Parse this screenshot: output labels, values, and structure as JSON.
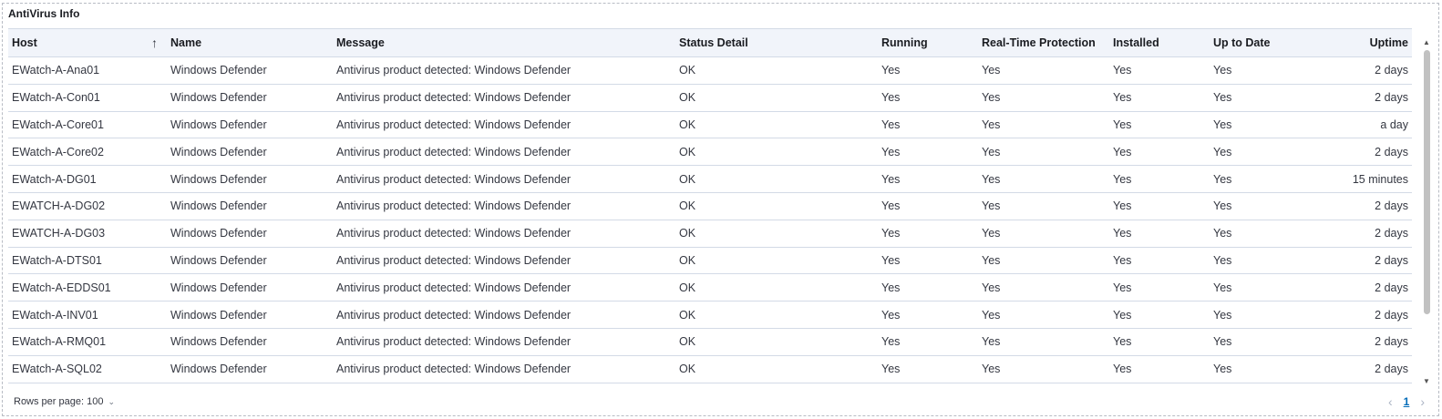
{
  "panel": {
    "title": "AntiVirus Info"
  },
  "table": {
    "columns": {
      "host": "Host",
      "name": "Name",
      "message": "Message",
      "status_detail": "Status Detail",
      "running": "Running",
      "realtime": "Real-Time Protection",
      "installed": "Installed",
      "up_to_date": "Up to Date",
      "uptime": "Uptime"
    },
    "sort_indicator": "↑",
    "rows": [
      {
        "host": "EWatch-A-Ana01",
        "name": "Windows Defender",
        "message": "Antivirus product detected: Windows Defender",
        "status": "OK",
        "running": "Yes",
        "realtime": "Yes",
        "installed": "Yes",
        "uptodate": "Yes",
        "uptime": "2 days"
      },
      {
        "host": "EWatch-A-Con01",
        "name": "Windows Defender",
        "message": "Antivirus product detected: Windows Defender",
        "status": "OK",
        "running": "Yes",
        "realtime": "Yes",
        "installed": "Yes",
        "uptodate": "Yes",
        "uptime": "2 days"
      },
      {
        "host": "EWatch-A-Core01",
        "name": "Windows Defender",
        "message": "Antivirus product detected: Windows Defender",
        "status": "OK",
        "running": "Yes",
        "realtime": "Yes",
        "installed": "Yes",
        "uptodate": "Yes",
        "uptime": "a day"
      },
      {
        "host": "EWatch-A-Core02",
        "name": "Windows Defender",
        "message": "Antivirus product detected: Windows Defender",
        "status": "OK",
        "running": "Yes",
        "realtime": "Yes",
        "installed": "Yes",
        "uptodate": "Yes",
        "uptime": "2 days"
      },
      {
        "host": "EWatch-A-DG01",
        "name": "Windows Defender",
        "message": "Antivirus product detected: Windows Defender",
        "status": "OK",
        "running": "Yes",
        "realtime": "Yes",
        "installed": "Yes",
        "uptodate": "Yes",
        "uptime": "15 minutes"
      },
      {
        "host": "EWATCH-A-DG02",
        "name": "Windows Defender",
        "message": "Antivirus product detected: Windows Defender",
        "status": "OK",
        "running": "Yes",
        "realtime": "Yes",
        "installed": "Yes",
        "uptodate": "Yes",
        "uptime": "2 days"
      },
      {
        "host": "EWATCH-A-DG03",
        "name": "Windows Defender",
        "message": "Antivirus product detected: Windows Defender",
        "status": "OK",
        "running": "Yes",
        "realtime": "Yes",
        "installed": "Yes",
        "uptodate": "Yes",
        "uptime": "2 days"
      },
      {
        "host": "EWatch-A-DTS01",
        "name": "Windows Defender",
        "message": "Antivirus product detected: Windows Defender",
        "status": "OK",
        "running": "Yes",
        "realtime": "Yes",
        "installed": "Yes",
        "uptodate": "Yes",
        "uptime": "2 days"
      },
      {
        "host": "EWatch-A-EDDS01",
        "name": "Windows Defender",
        "message": "Antivirus product detected: Windows Defender",
        "status": "OK",
        "running": "Yes",
        "realtime": "Yes",
        "installed": "Yes",
        "uptodate": "Yes",
        "uptime": "2 days"
      },
      {
        "host": "EWatch-A-INV01",
        "name": "Windows Defender",
        "message": "Antivirus product detected: Windows Defender",
        "status": "OK",
        "running": "Yes",
        "realtime": "Yes",
        "installed": "Yes",
        "uptodate": "Yes",
        "uptime": "2 days"
      },
      {
        "host": "EWatch-A-RMQ01",
        "name": "Windows Defender",
        "message": "Antivirus product detected: Windows Defender",
        "status": "OK",
        "running": "Yes",
        "realtime": "Yes",
        "installed": "Yes",
        "uptodate": "Yes",
        "uptime": "2 days"
      },
      {
        "host": "EWatch-A-SQL02",
        "name": "Windows Defender",
        "message": "Antivirus product detected: Windows Defender",
        "status": "OK",
        "running": "Yes",
        "realtime": "Yes",
        "installed": "Yes",
        "uptodate": "Yes",
        "uptime": "2 days"
      }
    ]
  },
  "footer": {
    "rows_per_page": "Rows per page: 100",
    "current_page": "1",
    "icons": {
      "dropdown": "chevron-down-icon",
      "prev": "chevron-left-icon",
      "next": "chevron-right-icon"
    }
  },
  "colors": {
    "header_bg": "#f1f4fa",
    "border": "#d3dae6",
    "link": "#006bb8",
    "text": "#343741"
  }
}
